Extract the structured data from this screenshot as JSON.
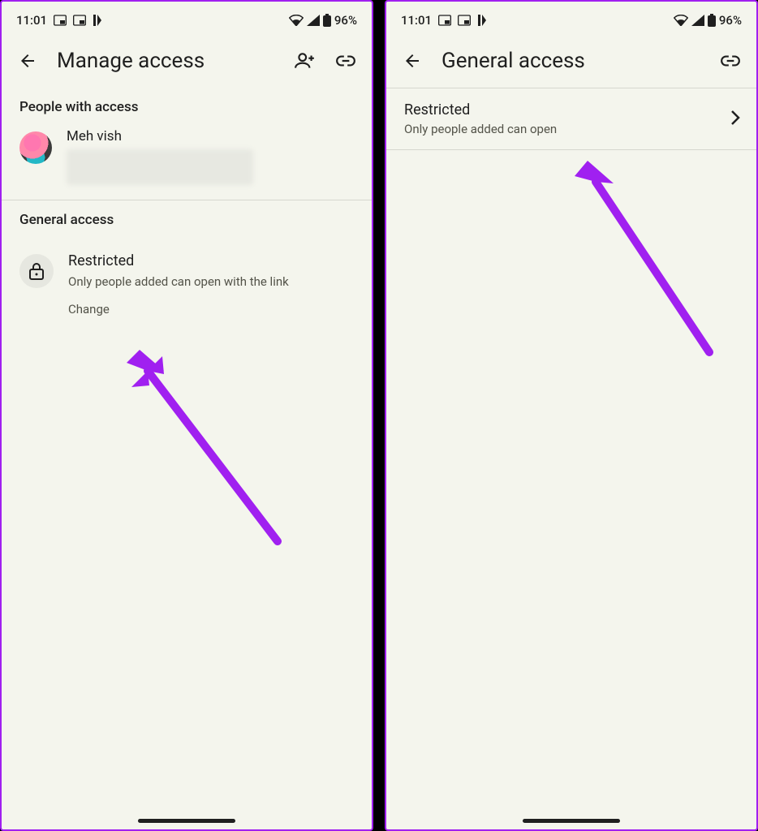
{
  "statusbar": {
    "time": "11:01",
    "battery": "96%"
  },
  "screen1": {
    "appbar": {
      "title": "Manage access"
    },
    "people": {
      "heading": "People with access",
      "person": {
        "name": "Meh vish"
      }
    },
    "general": {
      "heading": "General access",
      "title": "Restricted",
      "subtitle": "Only people added can open with the link",
      "change": "Change"
    }
  },
  "screen2": {
    "appbar": {
      "title": "General access"
    },
    "row": {
      "title": "Restricted",
      "subtitle": "Only people added can open"
    }
  }
}
